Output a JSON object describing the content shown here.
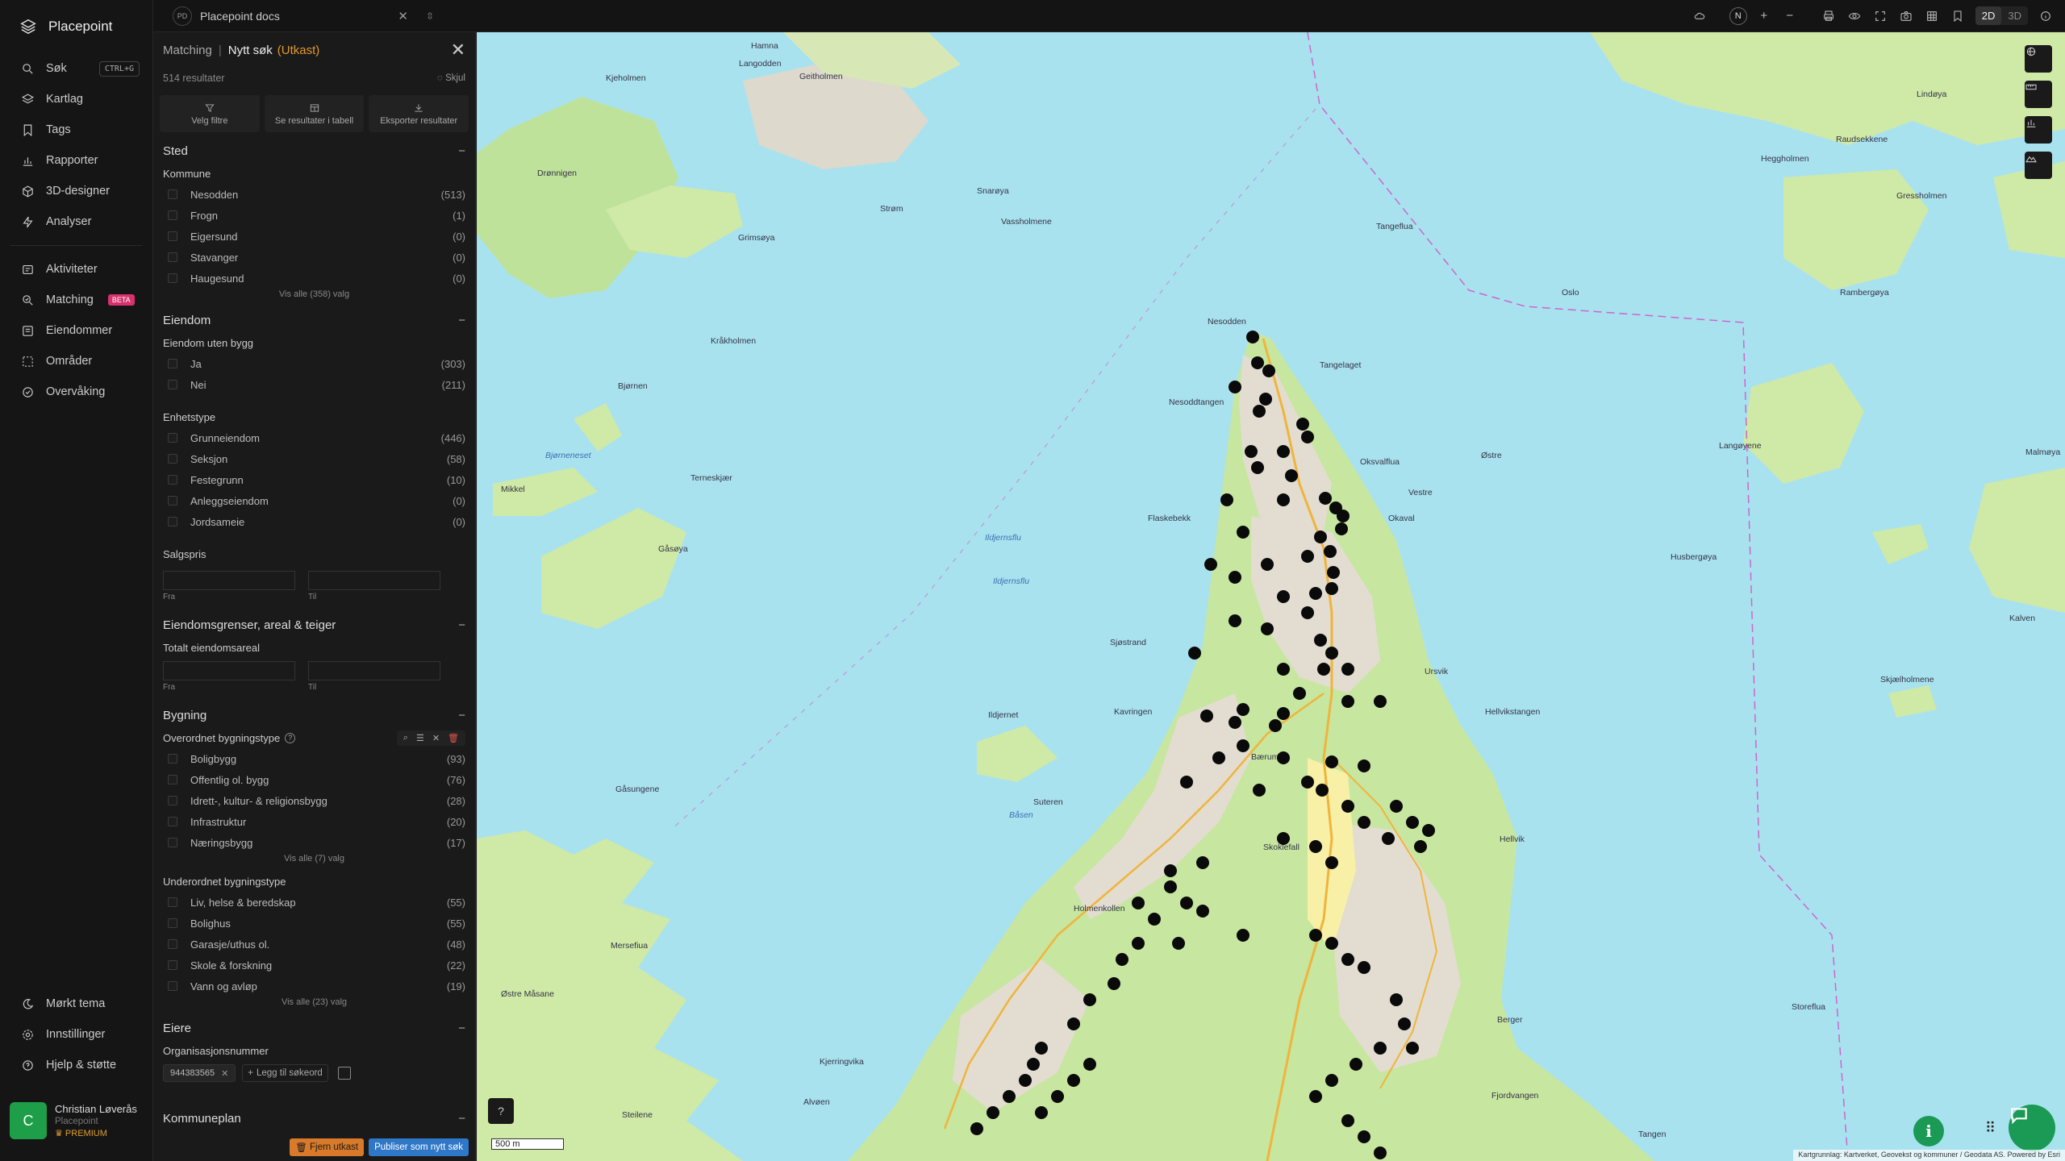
{
  "app": {
    "name": "Placepoint",
    "project_badge": "PD",
    "project_name": "Placepoint docs"
  },
  "nav": {
    "items": [
      {
        "label": "Søk",
        "shortcut": "CTRL+G"
      },
      {
        "label": "Kartlag"
      },
      {
        "label": "Tags"
      },
      {
        "label": "Rapporter"
      },
      {
        "label": "3D-designer"
      },
      {
        "label": "Analyser"
      }
    ],
    "items2": [
      {
        "label": "Aktiviteter"
      },
      {
        "label": "Matching",
        "badge": "BETA"
      },
      {
        "label": "Eiendommer"
      },
      {
        "label": "Områder"
      },
      {
        "label": "Overvåking"
      }
    ],
    "bottom": [
      {
        "label": "Mørkt tema"
      },
      {
        "label": "Innstillinger"
      },
      {
        "label": "Hjelp & støtte"
      }
    ],
    "user": {
      "initial": "C",
      "name": "Christian Løverås",
      "org": "Placepoint",
      "plan": "PREMIUM"
    }
  },
  "topbar": {
    "view_2d": "2D",
    "view_3d": "3D",
    "compass": "N"
  },
  "panel": {
    "crumb": "Matching",
    "title": "Nytt søk",
    "status": "(Utkast)",
    "results": "514 resultater",
    "hide": "Skjul",
    "actions": [
      "Velg filtre",
      "Se resultater i tabell",
      "Eksporter resultater"
    ],
    "sted": {
      "title": "Sted",
      "kommune_label": "Kommune",
      "kommune": [
        {
          "name": "Nesodden",
          "count": "(513)"
        },
        {
          "name": "Frogn",
          "count": "(1)"
        },
        {
          "name": "Eigersund",
          "count": "(0)"
        },
        {
          "name": "Stavanger",
          "count": "(0)"
        },
        {
          "name": "Haugesund",
          "count": "(0)"
        }
      ],
      "show_all": "Vis alle (358) valg"
    },
    "eiendom": {
      "title": "Eiendom",
      "uten_bygg_label": "Eiendom uten bygg",
      "uten_bygg": [
        {
          "name": "Ja",
          "count": "(303)"
        },
        {
          "name": "Nei",
          "count": "(211)"
        }
      ],
      "enhetstype_label": "Enhetstype",
      "enhetstype": [
        {
          "name": "Grunneiendom",
          "count": "(446)"
        },
        {
          "name": "Seksjon",
          "count": "(58)"
        },
        {
          "name": "Festegrunn",
          "count": "(10)"
        },
        {
          "name": "Anleggseiendom",
          "count": "(0)"
        },
        {
          "name": "Jordsameie",
          "count": "(0)"
        }
      ],
      "salgspris_label": "Salgspris",
      "from": "Fra",
      "to": "Til"
    },
    "grenser": {
      "title": "Eiendomsgrenser, areal & teiger",
      "areal_label": "Totalt eiendomsareal",
      "from": "Fra",
      "to": "Til"
    },
    "bygning": {
      "title": "Bygning",
      "overordnet_label": "Overordnet bygningstype",
      "overordnet": [
        {
          "name": "Boligbygg",
          "count": "(93)"
        },
        {
          "name": "Offentlig ol. bygg",
          "count": "(76)"
        },
        {
          "name": "Idrett-, kultur- & religionsbygg",
          "count": "(28)"
        },
        {
          "name": "Infrastruktur",
          "count": "(20)"
        },
        {
          "name": "Næringsbygg",
          "count": "(17)"
        }
      ],
      "overordnet_show_all": "Vis alle (7) valg",
      "underordnet_label": "Underordnet bygningstype",
      "underordnet": [
        {
          "name": "Liv, helse & beredskap",
          "count": "(55)"
        },
        {
          "name": "Bolighus",
          "count": "(55)"
        },
        {
          "name": "Garasje/uthus ol.",
          "count": "(48)"
        },
        {
          "name": "Skole & forskning",
          "count": "(22)"
        },
        {
          "name": "Vann og avløp",
          "count": "(19)"
        }
      ],
      "underordnet_show_all": "Vis alle (23) valg"
    },
    "eiere": {
      "title": "Eiere",
      "org_label": "Organisasjonsnummer",
      "org_value": "944383565",
      "add_keyword": "Legg til søkeord"
    },
    "kommuneplan": {
      "title": "Kommuneplan"
    },
    "btn_remove": "Fjern utkast",
    "btn_publish": "Publiser som nytt søk"
  },
  "map": {
    "scale": "500 m",
    "attribution": "Kartgrunnlag: Kartverket, Geovekst og kommuner / Geodata AS. Powered by Esri",
    "places": [
      "Hamna",
      "Langodden",
      "Kjeholmen",
      "Drønnigen",
      "Geitholmen",
      "Snarøya",
      "Vassholmene",
      "Strøm",
      "Grimsøya",
      "Kråkholmen",
      "Bjørnen",
      "Bjørneneset",
      "Terneskjær",
      "Mikkel",
      "Gåsøya",
      "Nesodden",
      "Tangelaget",
      "Nesoddtangen",
      "Oksvalflua",
      "Østre",
      "Vestre",
      "Okaval",
      "Flaskebekk",
      "Ildjernsflu",
      "Ildjernsflu",
      "Sjøstrand",
      "Ursvik",
      "Hellvikstangen",
      "Kavringen",
      "Ildjernet",
      "Suteren",
      "Båsen",
      "Gåsungene",
      "Mersefiua",
      "Østre Måsane",
      "Hellvik",
      "Berger",
      "Skoklefall",
      "Fjordvangen",
      "Storeflua",
      "Kjerringvika",
      "Alvøen",
      "Steilene",
      "Tangen",
      "Holmenkollen",
      "Lindøya",
      "Heggholmen",
      "Gressholmen",
      "Rambergøya",
      "Langøyene",
      "Malmøya",
      "Husbergøya",
      "Skjælholmene",
      "Tangeflua",
      "Oslo",
      "Bærum",
      "Raudsekkene",
      "Kalven"
    ]
  }
}
